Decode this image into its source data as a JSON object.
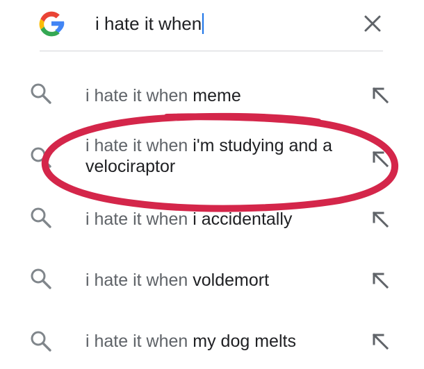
{
  "search": {
    "query": "i hate it when"
  },
  "icons": {
    "logo": "google-g-icon",
    "clear": "close-icon",
    "suggestion_leading": "search-icon",
    "suggestion_trailing": "arrow-up-left-icon"
  },
  "colors": {
    "logo_blue": "#4285F4",
    "logo_red": "#EA4335",
    "logo_yellow": "#FBBC05",
    "logo_green": "#34A853",
    "caret": "#1a73e8",
    "annotation_circle": "#d4264a"
  },
  "suggestions": [
    {
      "prefix": "i hate it when",
      "completion": "meme"
    },
    {
      "prefix": "i hate it when",
      "completion": "i'm studying and a velociraptor"
    },
    {
      "prefix": "i hate it when",
      "completion": "i accidentally"
    },
    {
      "prefix": "i hate it when",
      "completion": "voldemort"
    },
    {
      "prefix": "i hate it when",
      "completion": "my dog melts"
    }
  ],
  "annotation": {
    "type": "hand-drawn-circle",
    "highlighted_suggestion": 1
  }
}
